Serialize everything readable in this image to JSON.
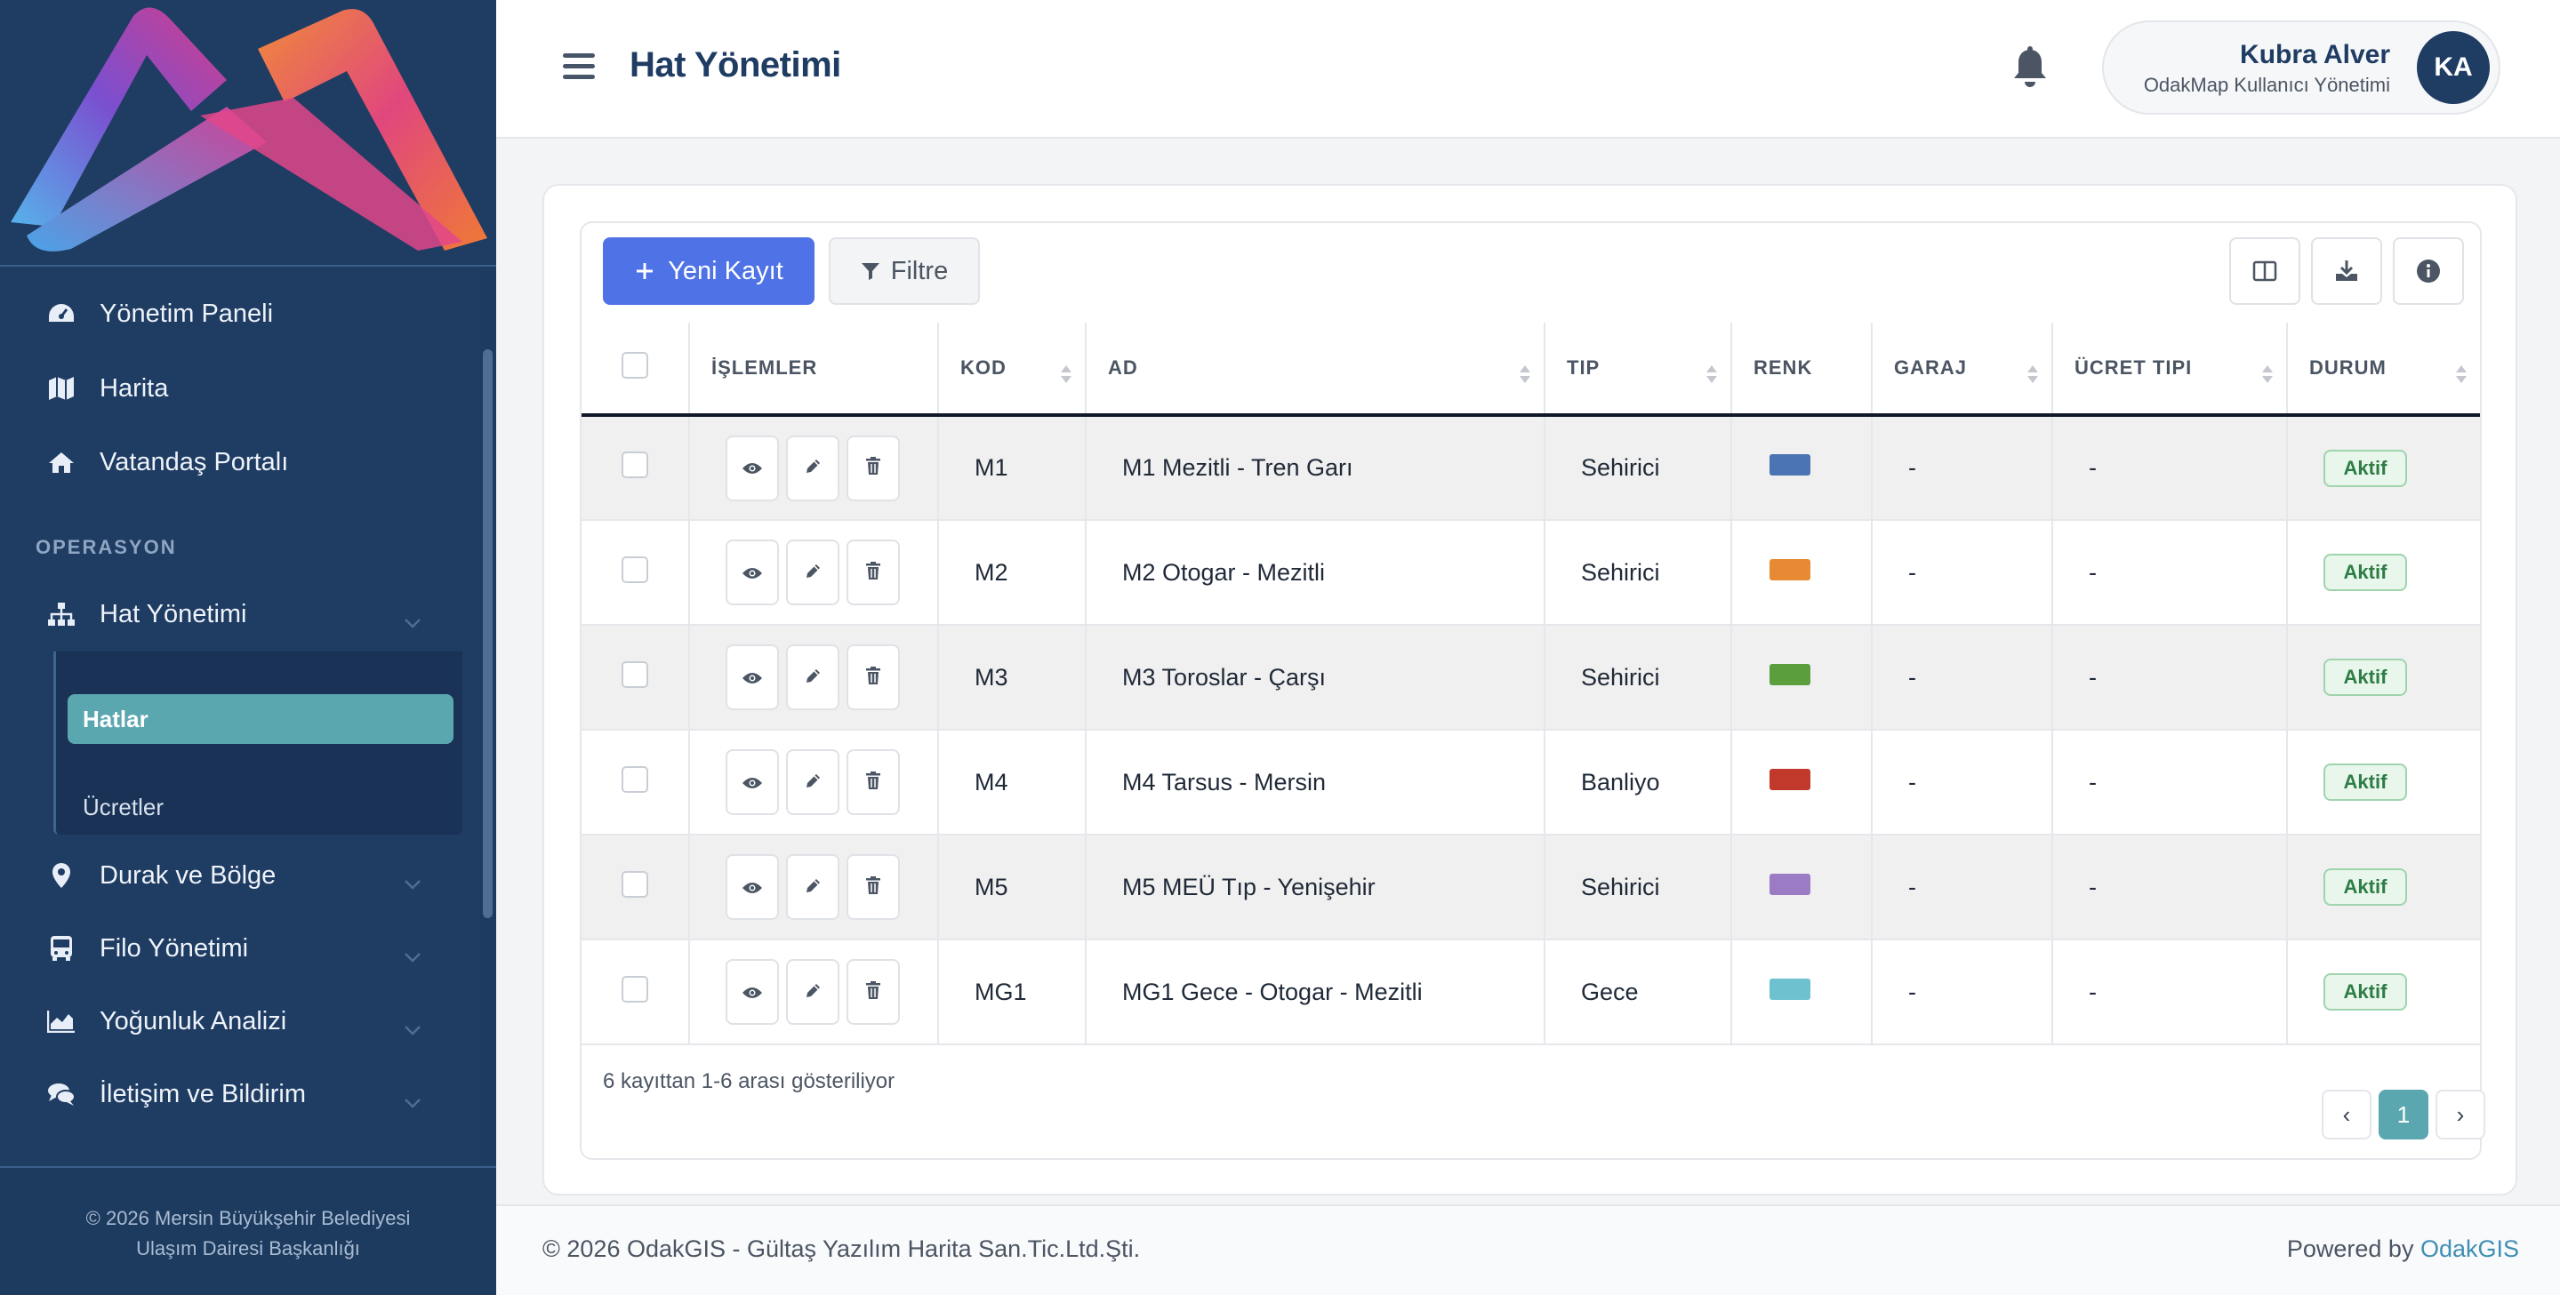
{
  "sidebar": {
    "items": [
      {
        "label": "Yönetim Paneli",
        "icon": "dashboard-icon"
      },
      {
        "label": "Harita",
        "icon": "map-icon"
      },
      {
        "label": "Vatandaş Portalı",
        "icon": "home-icon"
      }
    ],
    "section_label": "OPERASYON",
    "ops_items": [
      {
        "label": "Hat Yönetimi",
        "icon": "sitemap-icon"
      },
      {
        "label": "Durak ve Bölge",
        "icon": "map-pin-icon"
      },
      {
        "label": "Filo Yönetimi",
        "icon": "bus-icon"
      },
      {
        "label": "Yoğunluk Analizi",
        "icon": "area-chart-icon"
      },
      {
        "label": "İletişim ve Bildirim",
        "icon": "chat-icon"
      }
    ],
    "submenu": {
      "active": "Hatlar",
      "other": "Ücretler"
    },
    "footer_line1": "© 2026 Mersin Büyükşehir Belediyesi",
    "footer_line2": "Ulaşım Dairesi Başkanlığı"
  },
  "header": {
    "title": "Hat Yönetimi",
    "user_name": "Kubra Alver",
    "user_role": "OdakMap Kullanıcı Yönetimi",
    "user_initials": "KA"
  },
  "toolbar": {
    "new_label": "Yeni Kayıt",
    "filter_label": "Filtre"
  },
  "table": {
    "columns": [
      "İŞLEMLER",
      "KOD",
      "AD",
      "TIP",
      "RENK",
      "GARAJ",
      "ÜCRET TIPI",
      "DURUM"
    ],
    "rows": [
      {
        "kod": "M1",
        "ad": "M1 Mezitli - Tren Garı",
        "tip": "Sehirici",
        "renk": "#4a74b4",
        "garaj": "-",
        "ucret": "-",
        "durum": "Aktif"
      },
      {
        "kod": "M2",
        "ad": "M2 Otogar - Mezitli",
        "tip": "Sehirici",
        "renk": "#e88a33",
        "garaj": "-",
        "ucret": "-",
        "durum": "Aktif"
      },
      {
        "kod": "M3",
        "ad": "M3 Toroslar - Çarşı",
        "tip": "Sehirici",
        "renk": "#5a9e3e",
        "garaj": "-",
        "ucret": "-",
        "durum": "Aktif"
      },
      {
        "kod": "M4",
        "ad": "M4 Tarsus - Mersin",
        "tip": "Banliyo",
        "renk": "#c0392b",
        "garaj": "-",
        "ucret": "-",
        "durum": "Aktif"
      },
      {
        "kod": "M5",
        "ad": "M5 MEÜ Tıp - Yenişehir",
        "tip": "Sehirici",
        "renk": "#9b7cc4",
        "garaj": "-",
        "ucret": "-",
        "durum": "Aktif"
      },
      {
        "kod": "MG1",
        "ad": "MG1 Gece - Otogar - Mezitli",
        "tip": "Gece",
        "renk": "#6ec1cf",
        "garaj": "-",
        "ucret": "-",
        "durum": "Aktif"
      }
    ],
    "showing_text": "6 kayıttan 1-6 arası gösteriliyor",
    "pagination": {
      "prev": "‹",
      "page": "1",
      "next": "›"
    }
  },
  "footer": {
    "copyright": "© 2026 OdakGIS - Gültaş Yazılım Harita San.Tic.Ltd.Şti.",
    "powered_prefix": "Powered by ",
    "powered_brand": "OdakGIS"
  }
}
